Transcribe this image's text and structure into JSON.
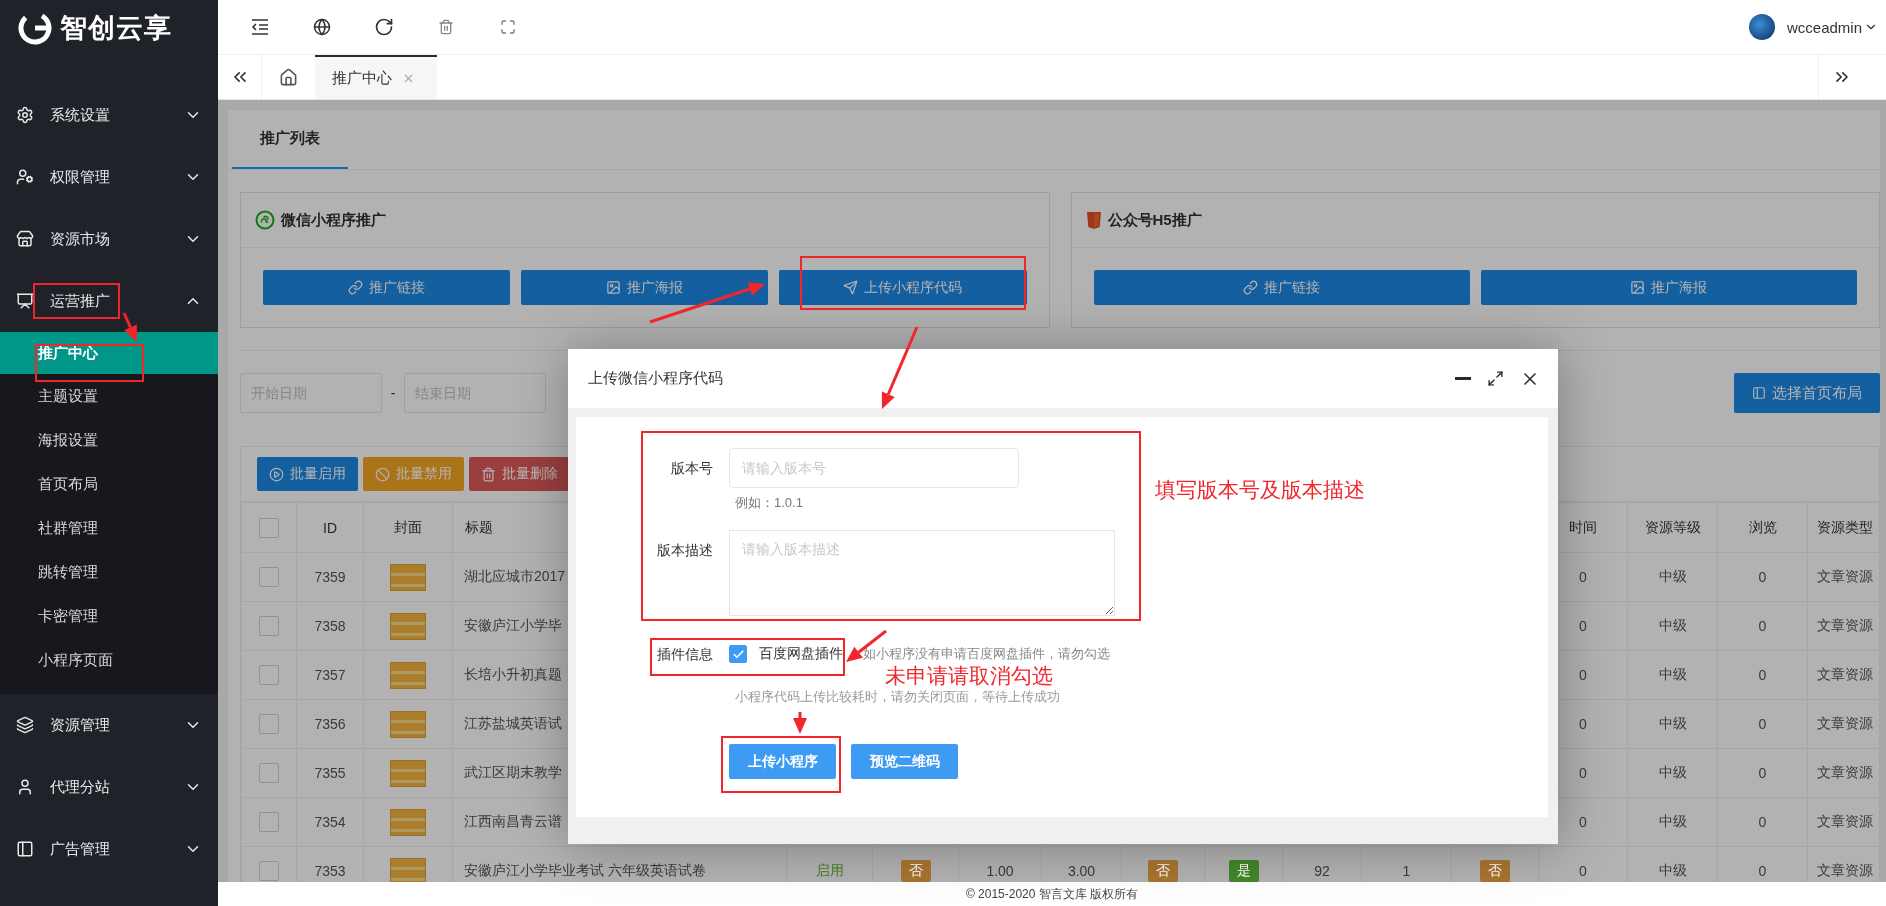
{
  "sidebar": {
    "logo": "智创云享",
    "items": [
      {
        "label": "系统设置",
        "kind": "gear",
        "expanded": false
      },
      {
        "label": "权限管理",
        "kind": "user-key",
        "expanded": false
      },
      {
        "label": "资源市场",
        "kind": "store",
        "expanded": false
      },
      {
        "label": "运营推广",
        "kind": "chart",
        "expanded": true,
        "children": [
          {
            "label": "推广中心",
            "selected": true
          },
          {
            "label": "主题设置",
            "selected": false
          },
          {
            "label": "海报设置",
            "selected": false
          },
          {
            "label": "首页布局",
            "selected": false
          },
          {
            "label": "社群管理",
            "selected": false
          },
          {
            "label": "跳转管理",
            "selected": false
          },
          {
            "label": "卡密管理",
            "selected": false
          },
          {
            "label": "小程序页面",
            "selected": false
          }
        ]
      },
      {
        "label": "资源管理",
        "kind": "layers",
        "expanded": false
      },
      {
        "label": "代理分站",
        "kind": "user",
        "expanded": false
      },
      {
        "label": "广告管理",
        "kind": "billboard",
        "expanded": false
      }
    ]
  },
  "header": {
    "user": "wcceadmin"
  },
  "page_tabs": [
    {
      "label": "推广中心",
      "selected": true
    }
  ],
  "section_tabs": [
    {
      "label": "推广列表",
      "selected": true
    }
  ],
  "cards": [
    {
      "title": "微信小程序推广",
      "kind": "miniprogram",
      "buttons": [
        {
          "label": "推广链接",
          "kind": "link"
        },
        {
          "label": "推广海报",
          "kind": "image"
        },
        {
          "label": "上传小程序代码",
          "kind": "send"
        }
      ]
    },
    {
      "title": "公众号H5推广",
      "kind": "h5",
      "buttons": [
        {
          "label": "推广链接",
          "kind": "link"
        },
        {
          "label": "推广海报",
          "kind": "image"
        }
      ]
    }
  ],
  "filters": {
    "start_placeholder": "开始日期",
    "separator": "-",
    "end_placeholder": "结束日期",
    "layout_button": "选择首页布局"
  },
  "toolbar": [
    {
      "label": "批量启用",
      "kind": "enable"
    },
    {
      "label": "批量禁用",
      "kind": "disable"
    },
    {
      "label": "批量删除",
      "kind": "delete"
    }
  ],
  "table": {
    "all_selected": false,
    "columns_left": [
      "ID",
      "封面",
      "标题"
    ],
    "columns_right": [
      "时间",
      "资源等级",
      "浏览",
      "资源类型"
    ],
    "rows": [
      {
        "id": "7359",
        "title": "湖北应城市2017",
        "selected": false,
        "tail": [
          "0",
          "中级",
          "0",
          "文章资源"
        ]
      },
      {
        "id": "7358",
        "title": "安徽庐江小学毕",
        "selected": false,
        "tail": [
          "0",
          "中级",
          "0",
          "文章资源"
        ]
      },
      {
        "id": "7357",
        "title": "长培小升初真题",
        "selected": false,
        "tail": [
          "0",
          "中级",
          "0",
          "文章资源"
        ]
      },
      {
        "id": "7356",
        "title": "江苏盐城英语试",
        "selected": false,
        "tail": [
          "0",
          "中级",
          "0",
          "文章资源"
        ]
      },
      {
        "id": "7355",
        "title": "武江区期末教学",
        "selected": false,
        "tail": [
          "0",
          "中级",
          "0",
          "文章资源"
        ]
      },
      {
        "id": "7354",
        "title": "江西南昌青云谱",
        "selected": false,
        "tail": [
          "0",
          "中级",
          "0",
          "文章资源"
        ]
      },
      {
        "id": "7353",
        "title": "安徽庐江小学毕业考试 六年级英语试卷",
        "selected": false,
        "middle": [
          {
            "text": "启用",
            "kind": "status"
          },
          {
            "text": "否",
            "kind": "tag",
            "color": "#a97530"
          },
          {
            "text": "1.00",
            "kind": "plain"
          },
          {
            "text": "3.00",
            "kind": "plain"
          },
          {
            "text": "否",
            "kind": "tag",
            "color": "#a97530"
          },
          {
            "text": "是",
            "kind": "tag",
            "color": "#44862a"
          },
          {
            "text": "92",
            "kind": "plain"
          },
          {
            "text": "1",
            "kind": "plain"
          },
          {
            "text": "否",
            "kind": "tag",
            "color": "#a97530"
          }
        ],
        "tail": [
          "0",
          "中级",
          "0",
          "文章资源"
        ]
      }
    ]
  },
  "modal": {
    "title": "上传微信小程序代码",
    "fields": [
      {
        "kind": "input",
        "label": "版本号",
        "placeholder": "请输入版本号",
        "hint": "例如：1.0.1"
      },
      {
        "kind": "textarea",
        "label": "版本描述",
        "placeholder": "请输入版本描述"
      }
    ],
    "plugin": {
      "label": "插件信息",
      "option": "百度网盘插件",
      "checked": true,
      "hint": "如小程序没有申请百度网盘插件，请勿勾选"
    },
    "notice": "小程序代码上传比较耗时，请勿关闭页面，等待上传成功",
    "buttons": [
      "上传小程序",
      "预览二维码"
    ]
  },
  "annotations": [
    "填写版本号及版本描述",
    "未申请请取消勾选"
  ],
  "footer": "© 2015-2020 智言文库 版权所有"
}
